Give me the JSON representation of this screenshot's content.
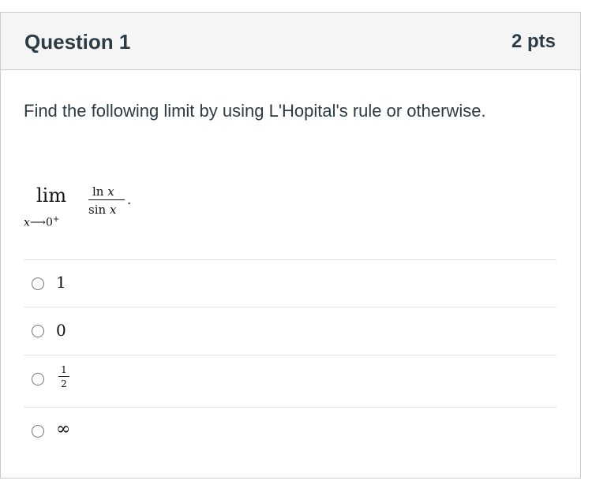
{
  "question": {
    "title": "Question 1",
    "points": "2 pts",
    "prompt": "Find the following limit by using L'Hopital's rule or otherwise.",
    "expression": {
      "operator": "lim",
      "subscript_var": "x",
      "subscript_arrow": "⟶",
      "subscript_target": "0",
      "subscript_sup": "+",
      "numerator_fn": "ln",
      "numerator_var": "x",
      "denominator_fn": "sin",
      "denominator_var": "x",
      "terminator": "."
    }
  },
  "answers": [
    {
      "label": "1",
      "selected": false
    },
    {
      "label": "0",
      "selected": false
    },
    {
      "numerator": "1",
      "denominator": "2",
      "selected": false
    },
    {
      "label": "∞",
      "selected": false
    }
  ],
  "colors": {
    "header_bg": "#f5f5f5",
    "border": "#c7cdd1",
    "divider": "#e1e4e6",
    "text": "#2d3b45"
  }
}
